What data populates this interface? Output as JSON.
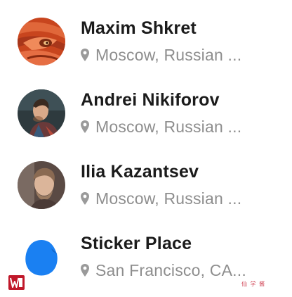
{
  "contacts": [
    {
      "name": "Maxim Shkret",
      "location": "Moscow, Russian ...",
      "avatar": "red-dragon-art-avatar"
    },
    {
      "name": "Andrei Nikiforov",
      "location": "Moscow, Russian ...",
      "avatar": "man-photo-avatar"
    },
    {
      "name": "Ilia Kazantsev",
      "location": "Moscow, Russian ...",
      "avatar": "man-photo-avatar"
    },
    {
      "name": "Sticker Place",
      "location": "San Francisco, CA...",
      "avatar": "blue-sticker-logo-avatar"
    }
  ],
  "colors": {
    "name": "#1b1b1b",
    "location": "#8e8e8e",
    "pin": "#9a9a9a",
    "sticker_blue": "#1a80f2"
  },
  "icons": {
    "location": "map-pin-icon",
    "corner_logo": "app-logo-icon"
  },
  "watermark": "仙 学 酱"
}
